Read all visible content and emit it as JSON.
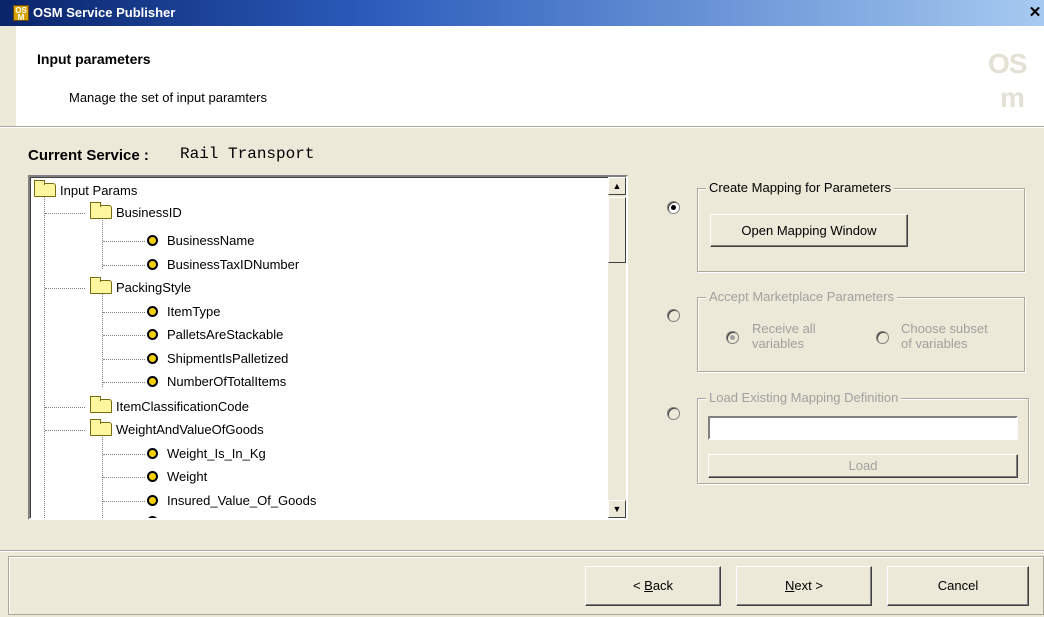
{
  "window": {
    "title": "OSM Service Publisher",
    "close_glyph": "✕",
    "icon_text": "OS M"
  },
  "header": {
    "title": "Input parameters",
    "subtitle": "Manage the set of input paramters",
    "logo_top": "OS",
    "logo_bottom": "m"
  },
  "current_service": {
    "label": "Current Service",
    "separator": ":",
    "value": "Rail Transport"
  },
  "tree": {
    "root": "Input Params",
    "groups": [
      {
        "label": "BusinessID",
        "children": [
          "BusinessName",
          "BusinessTaxIDNumber"
        ]
      },
      {
        "label": "PackingStyle",
        "children": [
          "ItemType",
          "PalletsAreStackable",
          "ShipmentIsPalletized",
          "NumberOfTotalItems"
        ]
      },
      {
        "label": "ItemClassificationCode",
        "children": []
      },
      {
        "label": "WeightAndValueOfGoods",
        "children": [
          "Weight_Is_In_Kg",
          "Weight",
          "Insured_Value_Of_Goods"
        ]
      }
    ]
  },
  "options": {
    "create_mapping": {
      "legend": "Create Mapping for Parameters",
      "button": "Open Mapping Window",
      "selected": true
    },
    "accept_marketplace": {
      "legend": "Accept Marketplace Parameters",
      "receive_all_line1": "Receive all",
      "receive_all_line2": "variables",
      "choose_subset_line1": "Choose subset",
      "choose_subset_line2": "of variables",
      "selected": false,
      "enabled": false
    },
    "load_existing": {
      "legend": "Load Existing Mapping Definition",
      "input_value": "",
      "button": "Load",
      "selected": false
    }
  },
  "footer": {
    "back": {
      "prefix": "< ",
      "mnemonic": "B",
      "rest": "ack"
    },
    "next": {
      "mnemonic": "N",
      "rest": "ext >"
    },
    "cancel": "Cancel"
  },
  "icons": {
    "scroll_up": "▲",
    "scroll_down": "▼"
  }
}
